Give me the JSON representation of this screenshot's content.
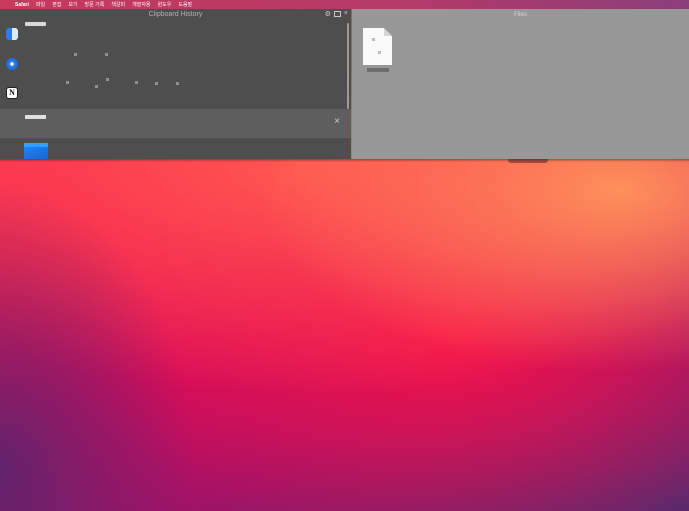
{
  "menubar": {
    "apple": "",
    "app_name": "Safari",
    "items": [
      "파일",
      "편집",
      "보기",
      "방문 기록",
      "책갈피",
      "개발자용",
      "윈도우",
      "도움말"
    ]
  },
  "clipboard_panel": {
    "title": "Clipboard History",
    "close_glyph": "×",
    "star_glyph": "☆",
    "settings_glyph": "⚙"
  },
  "files_panel": {
    "title": "Files"
  },
  "icons": {
    "finder": "finder-icon",
    "safari": "safari-icon",
    "notion": "notion-icon",
    "notion_letter": "N",
    "star": "star-icon",
    "bus": "bus-icon",
    "close": "close-icon",
    "document": "document-icon"
  },
  "colors": {
    "menubar": "#c73a5c",
    "clipboard_bg": "#4e4e4e",
    "selected_row": "#5e5e5e",
    "files_bg": "#989898",
    "wallpaper_primary": "#f5124f"
  }
}
